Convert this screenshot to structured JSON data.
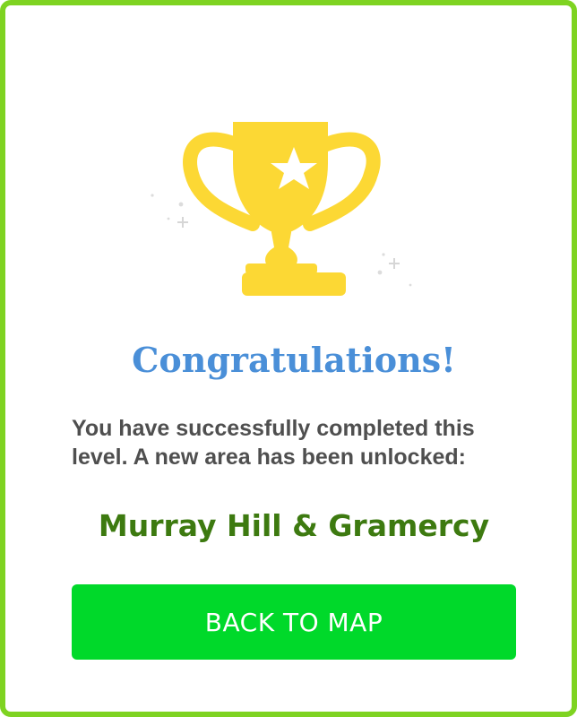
{
  "dialog": {
    "title": "Congratulations!",
    "message": "You have successfully completed this level. A new area has been unlocked:",
    "unlocked_area": "Murray Hill & Gramercy",
    "back_button_label": "BACK TO MAP",
    "icon": "trophy-icon"
  },
  "colors": {
    "border": "#7ed321",
    "title": "#4a8fd8",
    "message": "#4f4f4f",
    "area_name": "#3d7a10",
    "button": "#00d92a",
    "trophy": "#fcd834"
  }
}
